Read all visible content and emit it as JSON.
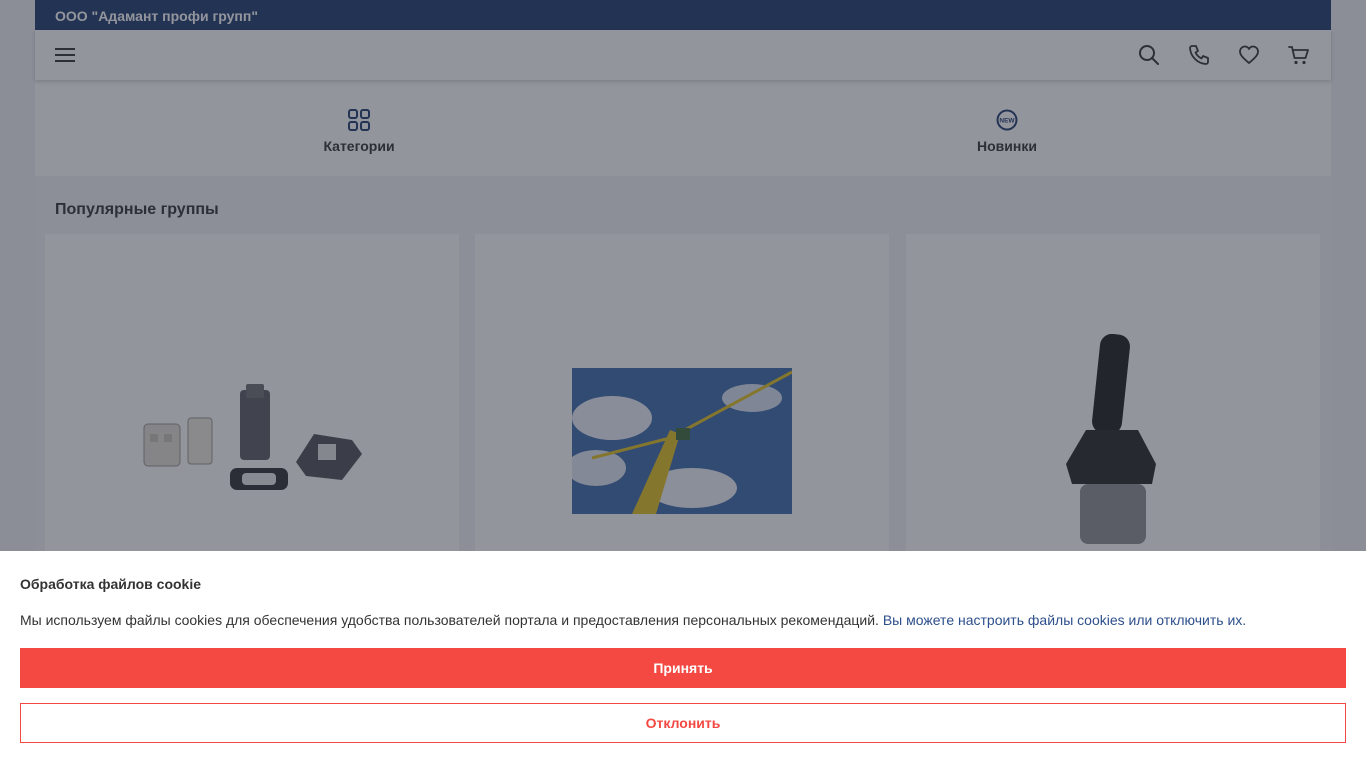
{
  "topbar": {
    "company": "ООО \"Адамант профи групп\""
  },
  "header": {
    "icons": [
      "menu-icon",
      "search-icon",
      "phone-icon",
      "heart-icon",
      "cart-icon"
    ]
  },
  "quicknav": {
    "categories_label": "Категории",
    "new_label": "Новинки",
    "new_badge": "NEW"
  },
  "popular": {
    "title": "Популярные группы",
    "cards": [
      {
        "image": "connector-housings-image"
      },
      {
        "image": "tower-crane-image"
      },
      {
        "image": "joystick-image"
      }
    ]
  },
  "cookie": {
    "title": "Обработка файлов cookie",
    "text": "Мы используем файлы cookies для обеспечения удобства пользователей портала и предоставления персональных рекомендаций.",
    "link": "Вы можете настроить файлы cookies или отключить их.",
    "accept_label": "Принять",
    "decline_label": "Отклонить"
  },
  "colors": {
    "topbar": "#1f3a6b",
    "accent": "#f44842",
    "link": "#2d4f8c"
  }
}
